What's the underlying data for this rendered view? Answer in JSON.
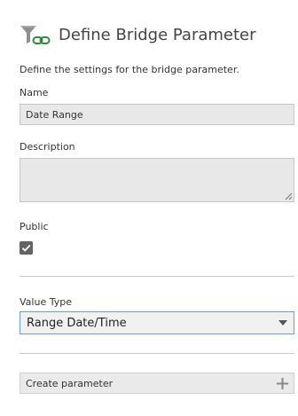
{
  "dialog": {
    "title": "Define Bridge Parameter",
    "intro": "Define the settings for the bridge parameter.",
    "header_icon": "funnel-chain-icon",
    "accent_color": "#2e8b3e"
  },
  "fields": {
    "name": {
      "label": "Name",
      "value": "Date Range"
    },
    "description": {
      "label": "Description",
      "value": ""
    },
    "public": {
      "label": "Public",
      "checked": true
    },
    "value_type": {
      "label": "Value Type",
      "selected": "Range Date/Time"
    }
  },
  "actions": {
    "create_label": "Create parameter",
    "create_icon": "plus-icon"
  }
}
